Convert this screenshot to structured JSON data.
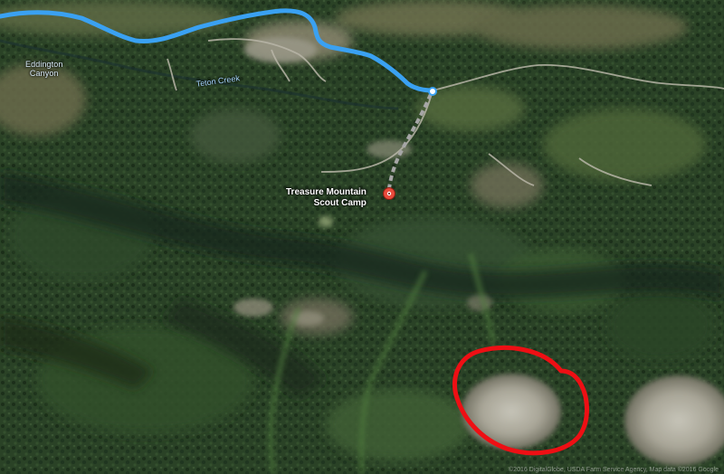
{
  "map": {
    "type": "satellite",
    "labels": {
      "canyon": [
        "Eddington",
        "Canyon"
      ],
      "creek": "Teton Creek",
      "poi": [
        "Treasure Mountain",
        "Scout Camp"
      ]
    },
    "attribution": "©2016 DigitalGlobe, USDA Farm Service Agency, Map data ©2016 Google",
    "colors": {
      "route": "#3aa1f2",
      "annotation_circle": "#ee0f14",
      "marker": "#e94b3c",
      "road": "#b9b6a8",
      "walking_path": "#9a9a9a",
      "forest": "#2a4226"
    },
    "icons": {
      "marker": "map-pin-icon",
      "route_end": "route-endpoint-icon"
    }
  }
}
